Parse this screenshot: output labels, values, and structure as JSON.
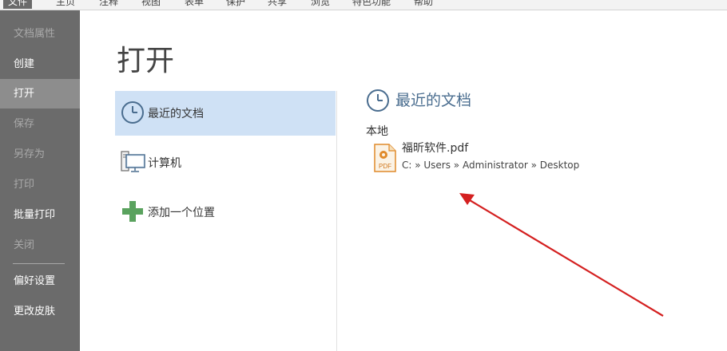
{
  "menu": {
    "items": [
      "文件",
      "主页",
      "注释",
      "视图",
      "表单",
      "保护",
      "共享",
      "浏览",
      "特色功能",
      "帮助"
    ]
  },
  "sidebar": {
    "items": [
      {
        "label": "文档属性",
        "state": "disabled"
      },
      {
        "label": "创建",
        "state": "normal"
      },
      {
        "label": "打开",
        "state": "active"
      },
      {
        "label": "保存",
        "state": "disabled"
      },
      {
        "label": "另存为",
        "state": "disabled"
      },
      {
        "label": "打印",
        "state": "disabled"
      },
      {
        "label": "批量打印",
        "state": "normal"
      },
      {
        "label": "关闭",
        "state": "disabled"
      },
      {
        "label": "偏好设置",
        "state": "normal"
      },
      {
        "label": "更改皮肤",
        "state": "normal"
      }
    ]
  },
  "main": {
    "title": "打开",
    "locations": [
      {
        "label": "最近的文档",
        "icon": "clock-icon",
        "selected": true
      },
      {
        "label": "计算机",
        "icon": "computer-icon",
        "selected": false
      },
      {
        "label": "添加一个位置",
        "icon": "plus-icon",
        "selected": false
      }
    ]
  },
  "recent": {
    "title": "最近的文档",
    "group_label": "本地",
    "files": [
      {
        "name": "福昕软件.pdf",
        "path": "C: » Users » Administrator » Desktop",
        "icon": "pdf-file-icon",
        "icon_text": "PDF"
      }
    ]
  },
  "colors": {
    "sidebar_bg": "#6b6b6b",
    "sidebar_active": "#8d8d8d",
    "selected_bg": "#cfe1f5",
    "header_blue": "#4a6d8f",
    "annotation_arrow": "#d42020"
  }
}
